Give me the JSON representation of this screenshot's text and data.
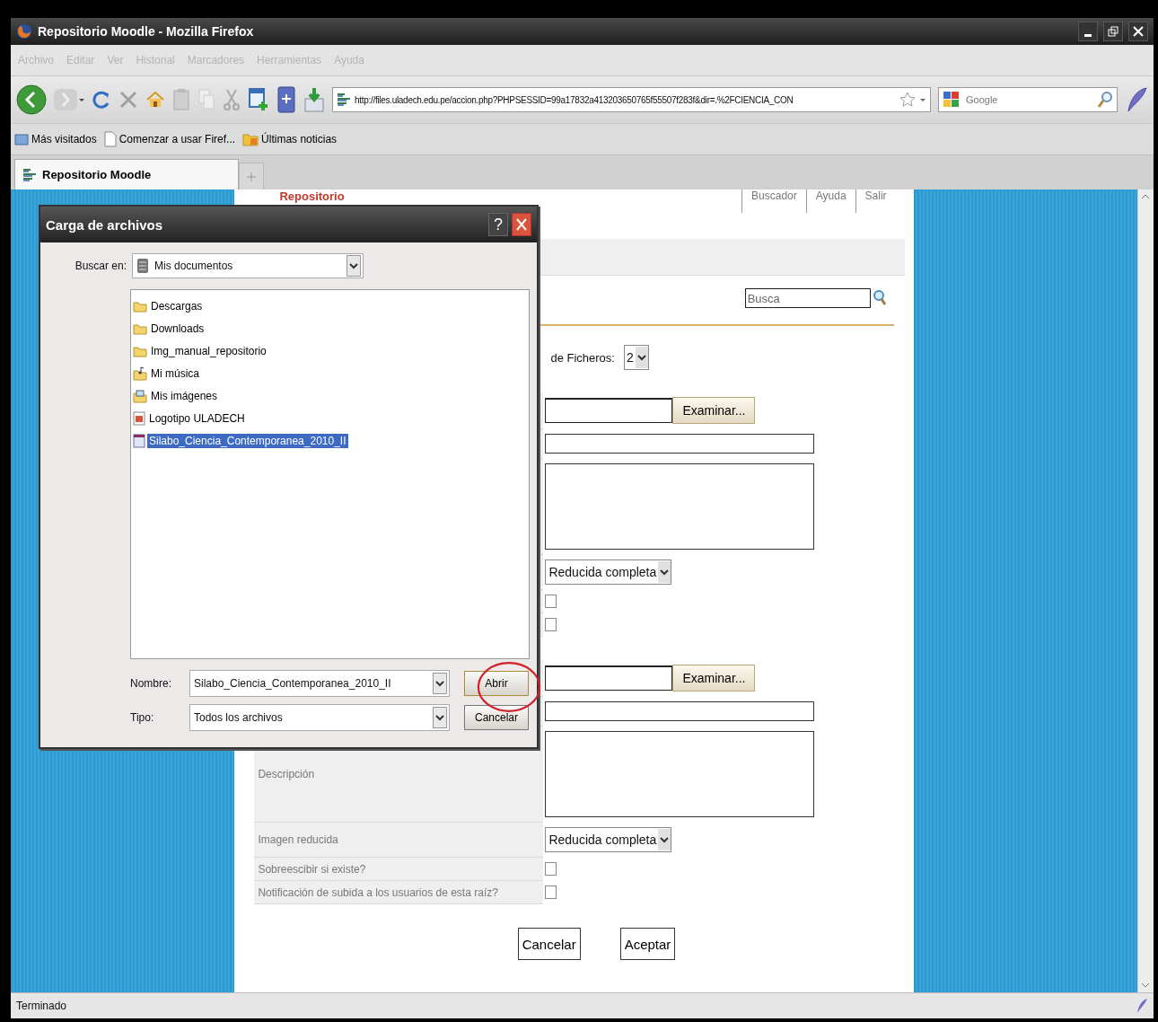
{
  "window": {
    "title": "Repositorio Moodle - Mozilla Firefox"
  },
  "menu": [
    {
      "label": "Archivo",
      "disabled": true
    },
    {
      "label": "Editar",
      "disabled": true
    },
    {
      "label": "Ver",
      "disabled": true
    },
    {
      "label": "Historial",
      "disabled": true
    },
    {
      "label": "Marcadores",
      "disabled": true
    },
    {
      "label": "Herramientas",
      "disabled": true
    },
    {
      "label": "Ayuda",
      "disabled": true
    }
  ],
  "toolbar": {
    "url": "http://files.uladech.edu.pe/accion.php?PHPSESSID=99a17832a413203650765f55507f283f&dir=.%2FCIENCIA_CON",
    "search_placeholder": "Google"
  },
  "bookmarks": [
    {
      "label": "Más visitados",
      "kind": "smart"
    },
    {
      "label": "Comenzar a usar Firef...",
      "kind": "page"
    },
    {
      "label": "Últimas noticias",
      "kind": "feed"
    }
  ],
  "tabs": [
    {
      "label": "Repositorio Moodle",
      "selected": true
    }
  ],
  "page": {
    "logo": "Repositorio",
    "links": [
      "Buscador",
      "Ayuda",
      "Salir"
    ],
    "search_value": "Busca",
    "count_label": "de Ficheros:",
    "count_value": "2",
    "groups": [
      {
        "fields": [
          {
            "kind": "file",
            "button": "Examinar..."
          },
          {
            "kind": "text"
          },
          {
            "kind": "textarea"
          },
          {
            "kind": "select",
            "value": "Reducida completa"
          },
          {
            "kind": "checkbox",
            "checked": false
          },
          {
            "kind": "checkbox",
            "checked": false
          }
        ]
      },
      {
        "fields": [
          {
            "kind": "file",
            "button": "Examinar..."
          },
          {
            "kind": "text"
          },
          {
            "kind": "textarea",
            "label": "Descripción"
          },
          {
            "kind": "select",
            "label": "Imagen reducida",
            "value": "Reducida completa"
          },
          {
            "kind": "checkbox",
            "label": "Sobreescibir si existe?",
            "checked": false
          },
          {
            "kind": "checkbox",
            "label": "Notificación de subida a los usuarios de esta raíz?",
            "checked": false
          }
        ]
      }
    ],
    "buttons": [
      "Cancelar",
      "Aceptar"
    ]
  },
  "dialog": {
    "title": "Carga de archivos",
    "help": "?",
    "look_in_label": "Buscar en:",
    "look_in": "Mis documentos",
    "files": [
      {
        "name": "Descargas",
        "kind": "folder",
        "selected": false
      },
      {
        "name": "Downloads",
        "kind": "folder",
        "selected": false
      },
      {
        "name": "Img_manual_repositorio",
        "kind": "folder",
        "selected": false
      },
      {
        "name": "Mi música",
        "kind": "music-folder",
        "selected": false
      },
      {
        "name": "Mis imágenes",
        "kind": "pictures-folder",
        "selected": false
      },
      {
        "name": "Logotipo ULADECH",
        "kind": "image",
        "selected": false
      },
      {
        "name": "Silabo_Ciencia_Contemporanea_2010_II",
        "kind": "document",
        "selected": true
      }
    ],
    "name_label": "Nombre:",
    "name_value": "Silabo_Ciencia_Contemporanea_2010_II",
    "type_label": "Tipo:",
    "type_value": "Todos los archivos",
    "buttons": [
      "Abrir",
      "Cancelar"
    ]
  },
  "status_bar": "Terminado"
}
